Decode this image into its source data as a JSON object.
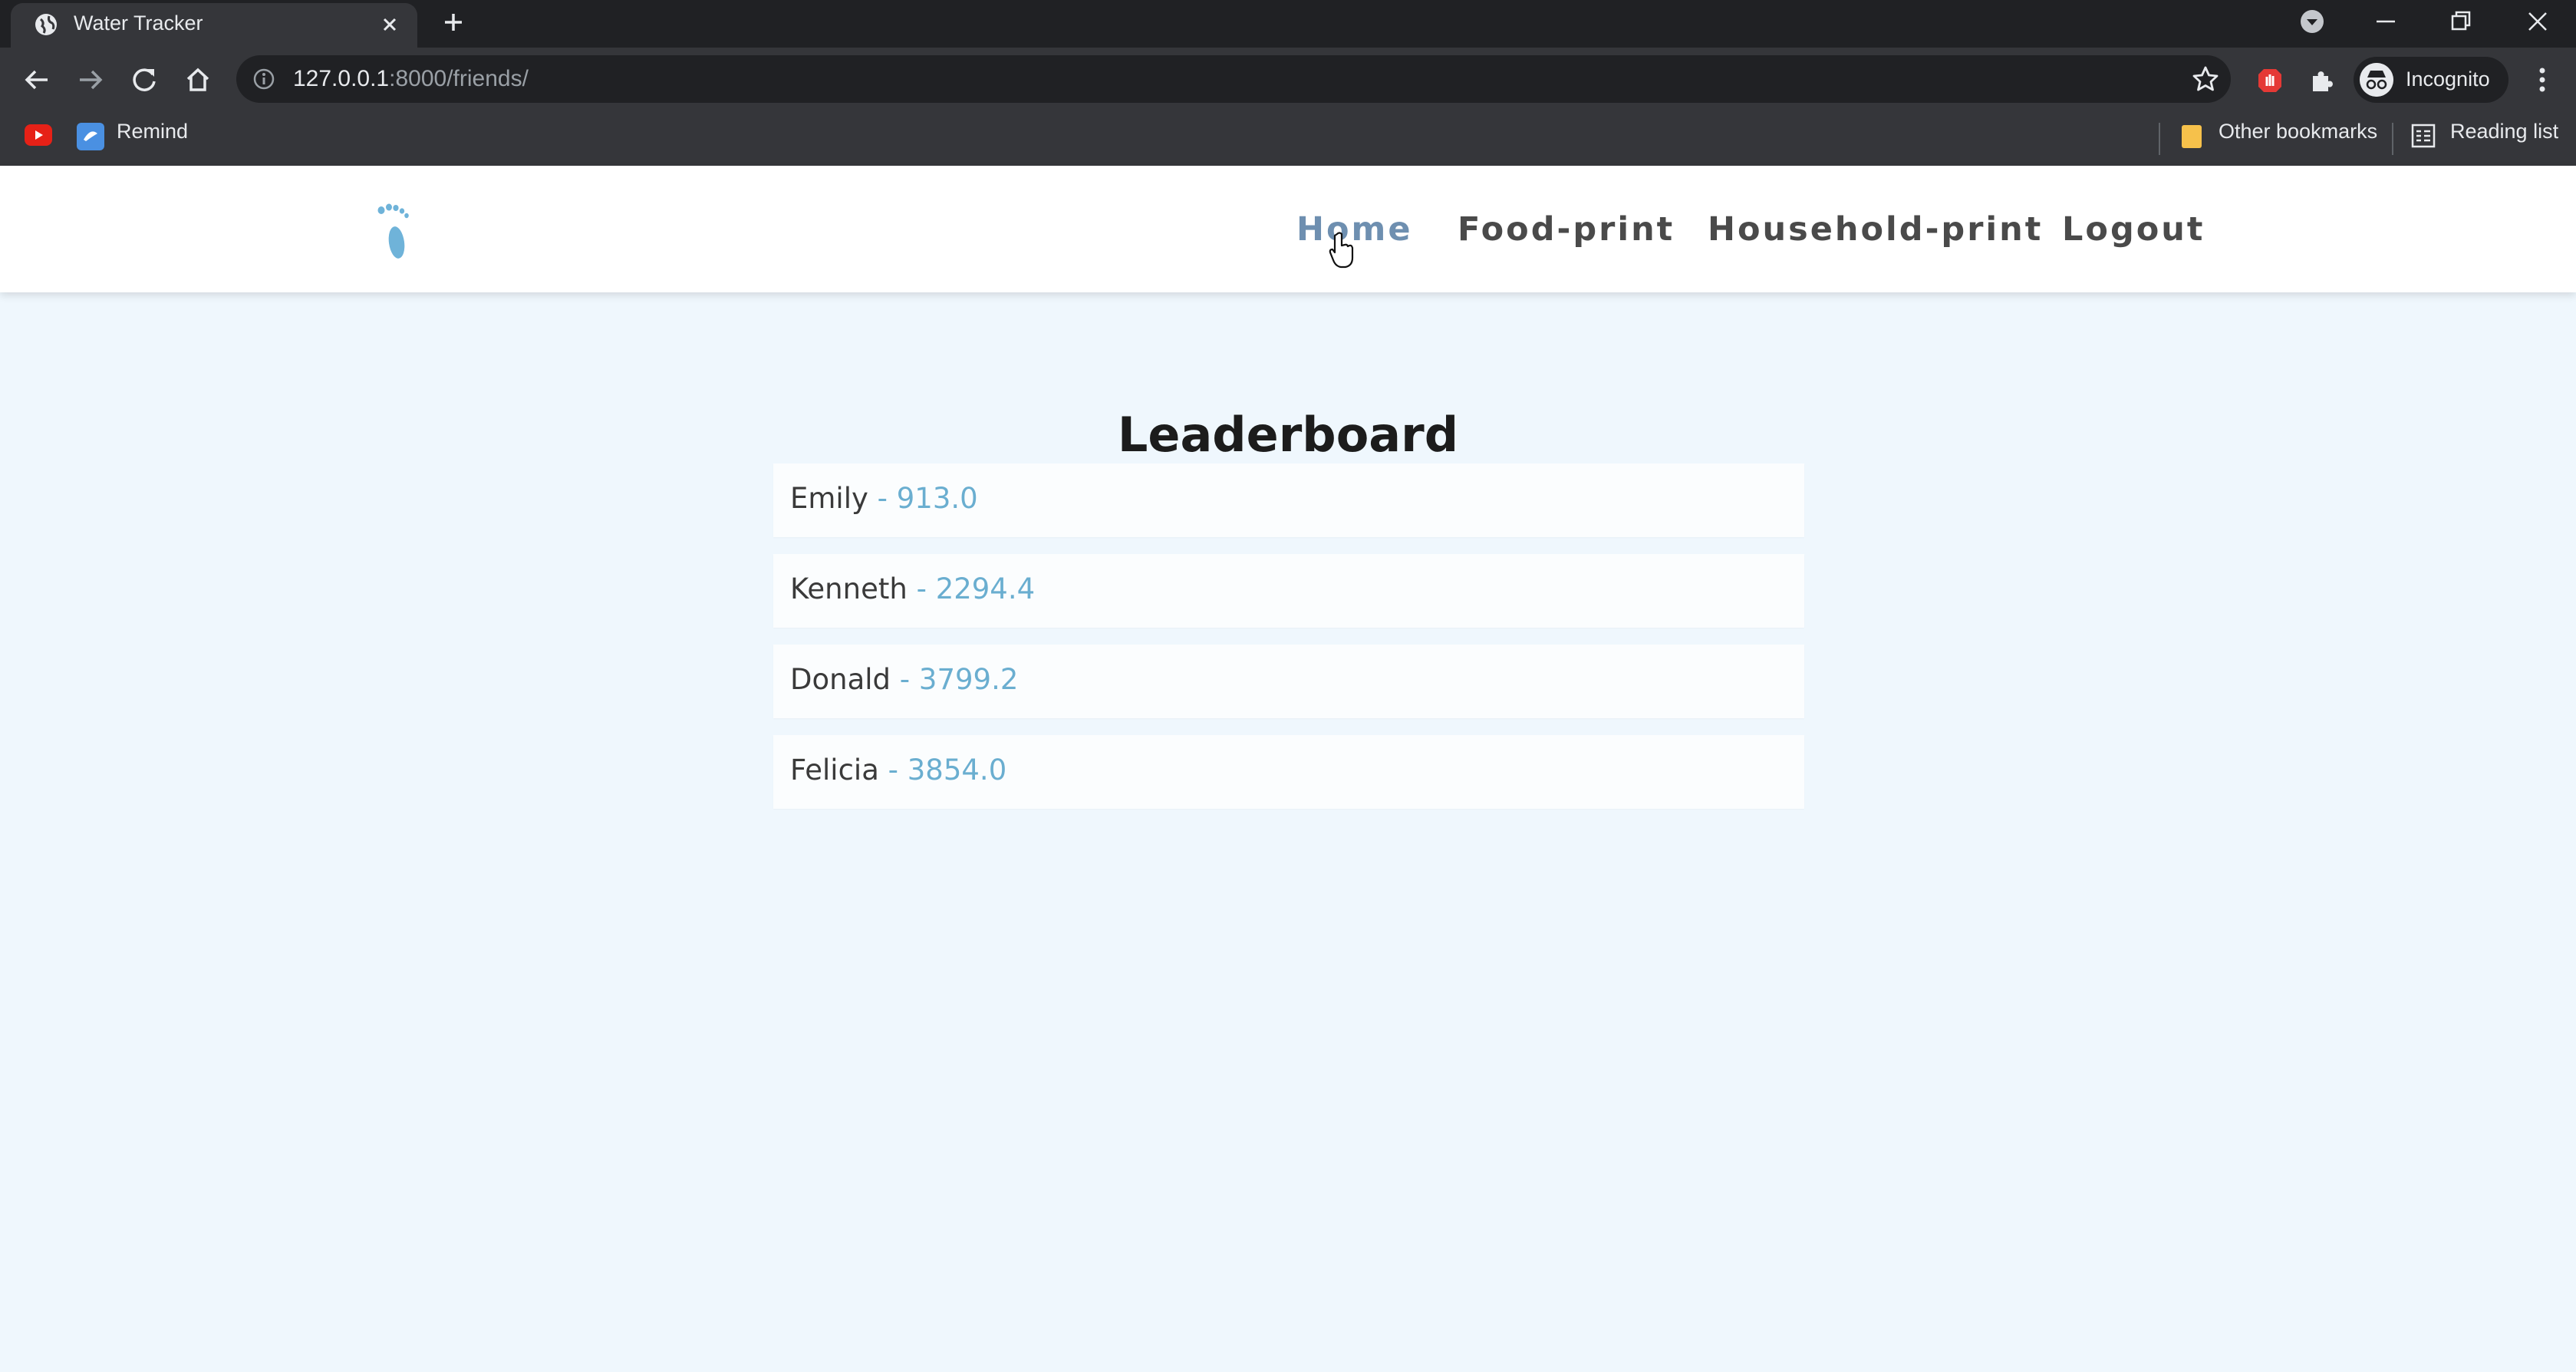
{
  "browser": {
    "tab": {
      "title": "Water Tracker"
    },
    "address_bar": {
      "host": "127.0.0.1",
      "path": ":8000/friends/"
    },
    "profile": {
      "label": "Incognito"
    },
    "bookmarks": [
      {
        "label": "Remind"
      }
    ],
    "bookmarks_right": {
      "other": "Other bookmarks",
      "reading_list": "Reading list"
    }
  },
  "site": {
    "nav": [
      {
        "label": "Home",
        "active": true
      },
      {
        "label": "Food-print",
        "active": false
      },
      {
        "label": "Household-print",
        "active": false
      },
      {
        "label": "Logout",
        "active": false
      }
    ]
  },
  "leaderboard": {
    "title": "Leaderboard",
    "separator": " - ",
    "entries": [
      {
        "name": "Emily",
        "score": "913.0"
      },
      {
        "name": "Kenneth",
        "score": "2294.4"
      },
      {
        "name": "Donald",
        "score": "3799.2"
      },
      {
        "name": "Felicia",
        "score": "3854.0"
      }
    ]
  },
  "colors": {
    "page_bg": "#eff7fd",
    "accent": "#6aaed0",
    "nav_active": "#6e8fb0",
    "logo": "#6fb3d9"
  }
}
